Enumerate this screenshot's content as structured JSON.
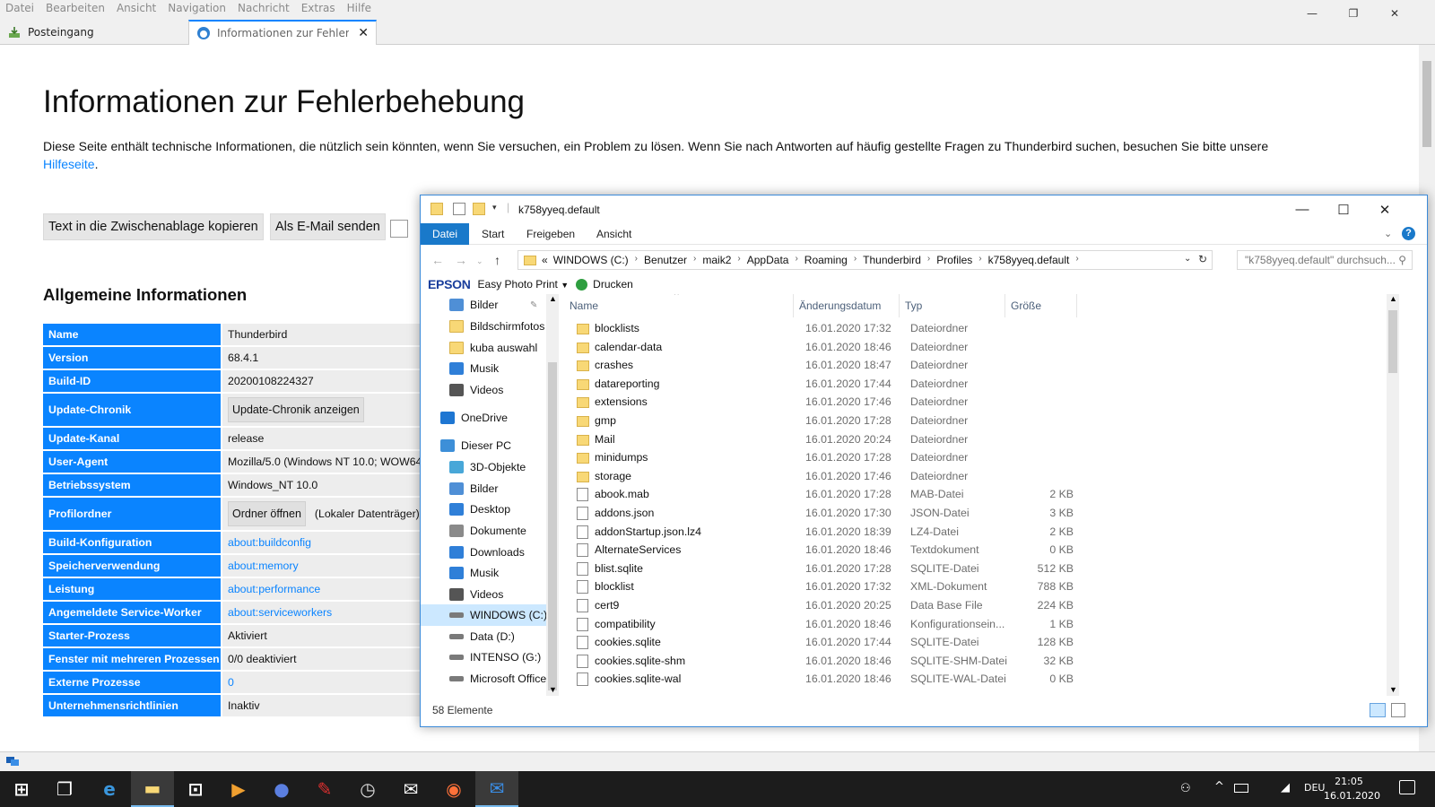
{
  "thunderbird": {
    "menu": [
      "Datei",
      "Bearbeiten",
      "Ansicht",
      "Navigation",
      "Nachricht",
      "Extras",
      "Hilfe"
    ],
    "tabs": [
      {
        "label": "Posteingang"
      },
      {
        "label": "Informationen zur Fehlerbeh"
      }
    ],
    "page": {
      "title": "Informationen zur Fehlerbehebung",
      "intro": "Diese Seite enthält technische Informationen, die nützlich sein könnten, wenn Sie versuchen, ein Problem zu lösen. Wenn Sie nach Antworten auf häufig gestellte Fragen zu Thunderbird suchen, besuchen Sie bitte unsere",
      "intro_link": "Hilfeseite",
      "intro_end": ".",
      "copy_button": "Text in die Zwischenablage kopieren",
      "email_button": "Als E-Mail senden",
      "section_title": "Allgemeine Informationen",
      "rows": [
        {
          "key": "Name",
          "value": "Thunderbird"
        },
        {
          "key": "Version",
          "value": "68.4.1"
        },
        {
          "key": "Build-ID",
          "value": "20200108224327"
        },
        {
          "key": "Update-Chronik",
          "button": "Update-Chronik anzeigen"
        },
        {
          "key": "Update-Kanal",
          "value": "release"
        },
        {
          "key": "User-Agent",
          "value": "Mozilla/5.0 (Windows NT 10.0; WOW64;"
        },
        {
          "key": "Betriebssystem",
          "value": "Windows_NT 10.0"
        },
        {
          "key": "Profilordner",
          "button": "Ordner öffnen",
          "value": "(Lokaler Datenträger)"
        },
        {
          "key": "Build-Konfiguration",
          "link": "about:buildconfig"
        },
        {
          "key": "Speicherverwendung",
          "link": "about:memory"
        },
        {
          "key": "Leistung",
          "link": "about:performance"
        },
        {
          "key": "Angemeldete Service-Worker",
          "link": "about:serviceworkers"
        },
        {
          "key": "Starter-Prozess",
          "value": "Aktiviert"
        },
        {
          "key": "Fenster mit mehreren Prozessen",
          "value": "0/0 deaktiviert"
        },
        {
          "key": "Externe Prozesse",
          "link": "0"
        },
        {
          "key": "Unternehmensrichtlinien",
          "value": "Inaktiv"
        }
      ]
    }
  },
  "explorer": {
    "title": "k758yyeq.default",
    "ribbon_tabs": [
      "Datei",
      "Start",
      "Freigeben",
      "Ansicht"
    ],
    "address_parts": [
      "WINDOWS (C:)",
      "Benutzer",
      "maik2",
      "AppData",
      "Roaming",
      "Thunderbird",
      "Profiles",
      "k758yyeq.default"
    ],
    "address_prefix": "«",
    "search_placeholder": "\"k758yyeq.default\" durchsuch...",
    "epson_logo": "EPSON",
    "epson_app": "Easy Photo Print",
    "print_label": "Drucken",
    "nav_items": [
      {
        "label": "Bilder",
        "icon": "pictures-icon",
        "pinned": true
      },
      {
        "label": "Bildschirmfotos",
        "icon": "folder-icon"
      },
      {
        "label": "kuba auswahl",
        "icon": "folder-icon"
      },
      {
        "label": "Musik",
        "icon": "music-icon"
      },
      {
        "label": "Videos",
        "icon": "videos-icon"
      },
      {
        "label": "OneDrive",
        "icon": "onedrive-icon"
      },
      {
        "label": "Dieser PC",
        "icon": "pc-icon"
      },
      {
        "label": "3D-Objekte",
        "icon": "3d-objects-icon"
      },
      {
        "label": "Bilder",
        "icon": "pictures-icon"
      },
      {
        "label": "Desktop",
        "icon": "desktop-icon"
      },
      {
        "label": "Dokumente",
        "icon": "documents-icon"
      },
      {
        "label": "Downloads",
        "icon": "downloads-icon"
      },
      {
        "label": "Musik",
        "icon": "music-icon"
      },
      {
        "label": "Videos",
        "icon": "videos-icon"
      },
      {
        "label": "WINDOWS (C:)",
        "icon": "drive-icon",
        "selected": true
      },
      {
        "label": "Data (D:)",
        "icon": "drive-icon"
      },
      {
        "label": "INTENSO (G:)",
        "icon": "drive-icon"
      },
      {
        "label": "Microsoft Office",
        "icon": "drive-icon"
      }
    ],
    "columns": [
      "Name",
      "Änderungsdatum",
      "Typ",
      "Größe"
    ],
    "files": [
      {
        "name": "blocklists",
        "date": "16.01.2020 17:32",
        "type": "Dateiordner",
        "size": "",
        "kind": "folder"
      },
      {
        "name": "calendar-data",
        "date": "16.01.2020 18:46",
        "type": "Dateiordner",
        "size": "",
        "kind": "folder"
      },
      {
        "name": "crashes",
        "date": "16.01.2020 18:47",
        "type": "Dateiordner",
        "size": "",
        "kind": "folder"
      },
      {
        "name": "datareporting",
        "date": "16.01.2020 17:44",
        "type": "Dateiordner",
        "size": "",
        "kind": "folder"
      },
      {
        "name": "extensions",
        "date": "16.01.2020 17:46",
        "type": "Dateiordner",
        "size": "",
        "kind": "folder"
      },
      {
        "name": "gmp",
        "date": "16.01.2020 17:28",
        "type": "Dateiordner",
        "size": "",
        "kind": "folder"
      },
      {
        "name": "Mail",
        "date": "16.01.2020 20:24",
        "type": "Dateiordner",
        "size": "",
        "kind": "folder"
      },
      {
        "name": "minidumps",
        "date": "16.01.2020 17:28",
        "type": "Dateiordner",
        "size": "",
        "kind": "folder"
      },
      {
        "name": "storage",
        "date": "16.01.2020 17:46",
        "type": "Dateiordner",
        "size": "",
        "kind": "folder"
      },
      {
        "name": "abook.mab",
        "date": "16.01.2020 17:28",
        "type": "MAB-Datei",
        "size": "2 KB",
        "kind": "doc"
      },
      {
        "name": "addons.json",
        "date": "16.01.2020 17:30",
        "type": "JSON-Datei",
        "size": "3 KB",
        "kind": "doc"
      },
      {
        "name": "addonStartup.json.lz4",
        "date": "16.01.2020 18:39",
        "type": "LZ4-Datei",
        "size": "2 KB",
        "kind": "doc"
      },
      {
        "name": "AlternateServices",
        "date": "16.01.2020 18:46",
        "type": "Textdokument",
        "size": "0 KB",
        "kind": "doc"
      },
      {
        "name": "blist.sqlite",
        "date": "16.01.2020 17:28",
        "type": "SQLITE-Datei",
        "size": "512 KB",
        "kind": "doc"
      },
      {
        "name": "blocklist",
        "date": "16.01.2020 17:32",
        "type": "XML-Dokument",
        "size": "788 KB",
        "kind": "doc"
      },
      {
        "name": "cert9",
        "date": "16.01.2020 20:25",
        "type": "Data Base File",
        "size": "224 KB",
        "kind": "doc"
      },
      {
        "name": "compatibility",
        "date": "16.01.2020 18:46",
        "type": "Konfigurationsein...",
        "size": "1 KB",
        "kind": "doc"
      },
      {
        "name": "cookies.sqlite",
        "date": "16.01.2020 17:44",
        "type": "SQLITE-Datei",
        "size": "128 KB",
        "kind": "doc"
      },
      {
        "name": "cookies.sqlite-shm",
        "date": "16.01.2020 18:46",
        "type": "SQLITE-SHM-Datei",
        "size": "32 KB",
        "kind": "doc"
      },
      {
        "name": "cookies.sqlite-wal",
        "date": "16.01.2020 18:46",
        "type": "SQLITE-WAL-Datei",
        "size": "0 KB",
        "kind": "doc"
      }
    ],
    "status": "58 Elemente"
  },
  "taskbar": {
    "apps": [
      "start-icon",
      "task-view-icon",
      "edge-icon",
      "file-explorer-icon",
      "store-icon",
      "media-player-icon",
      "app-icon",
      "pin-app-icon",
      "clock-app-icon",
      "mail-icon",
      "firefox-icon",
      "thunderbird-icon"
    ],
    "language": "DEU",
    "time": "21:05",
    "date": "16.01.2020"
  },
  "colors": {
    "link": "#0a84ff",
    "explorer_file_tab": "#1979ca",
    "selection": "#cce8ff"
  }
}
